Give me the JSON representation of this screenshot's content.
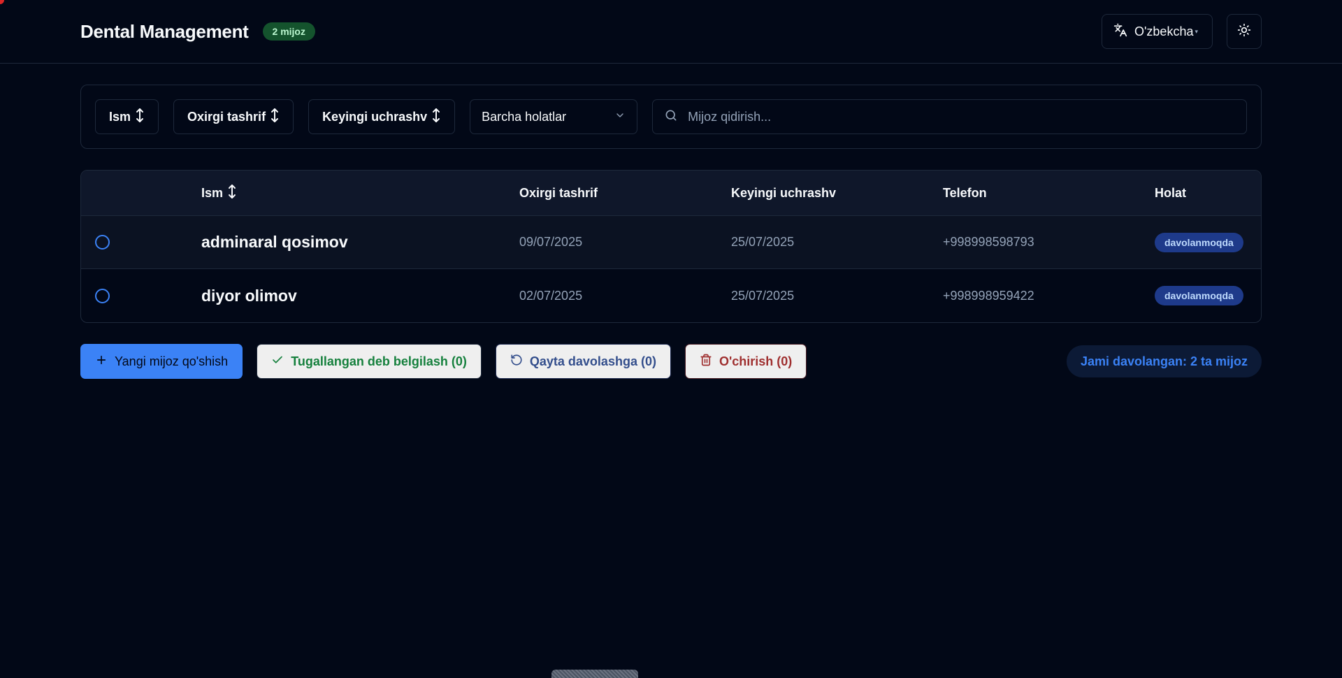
{
  "header": {
    "title": "Dental Management",
    "count_badge": "2 mijoz",
    "language_label": "O'zbekcha"
  },
  "filters": {
    "sort_name": "Ism",
    "sort_last_visit": "Oxirgi tashrif",
    "sort_next_appointment": "Keyingi uchrashv",
    "status_select": "Barcha holatlar",
    "search_placeholder": "Mijoz qidirish..."
  },
  "table": {
    "columns": {
      "name": "Ism",
      "last_visit": "Oxirgi tashrif",
      "next_appointment": "Keyingi uchrashv",
      "phone": "Telefon",
      "status": "Holat"
    },
    "rows": [
      {
        "name": "adminaral qosimov",
        "last_visit": "09/07/2025",
        "next_appointment": "25/07/2025",
        "phone": "+998998598793",
        "status": "davolanmoqda"
      },
      {
        "name": "diyor olimov",
        "last_visit": "02/07/2025",
        "next_appointment": "25/07/2025",
        "phone": "+998998959422",
        "status": "davolanmoqda"
      }
    ]
  },
  "actions": {
    "add_client": "Yangi mijoz qo'shish",
    "mark_completed": "Tugallangan deb belgilash (0)",
    "retreat": "Qayta davolashga (0)",
    "delete": "O'chirish (0)",
    "total_treated": "Jami davolangan: 2 ta mijoz"
  },
  "icons": {
    "language": "translate-icon",
    "theme": "sun-icon",
    "sort": "arrow-up-down-icon",
    "search": "search-icon",
    "dropdown": "chevron-down-icon",
    "add": "plus-icon",
    "check": "check-icon",
    "retreat": "rotate-ccw-icon",
    "delete": "trash-icon"
  },
  "colors": {
    "background": "#020817",
    "primary": "#3b82f6",
    "count_badge_bg": "#14532d",
    "status_badge_bg": "#1e3a8a",
    "success_text": "#15803d",
    "danger_text": "#9f2f2f"
  }
}
